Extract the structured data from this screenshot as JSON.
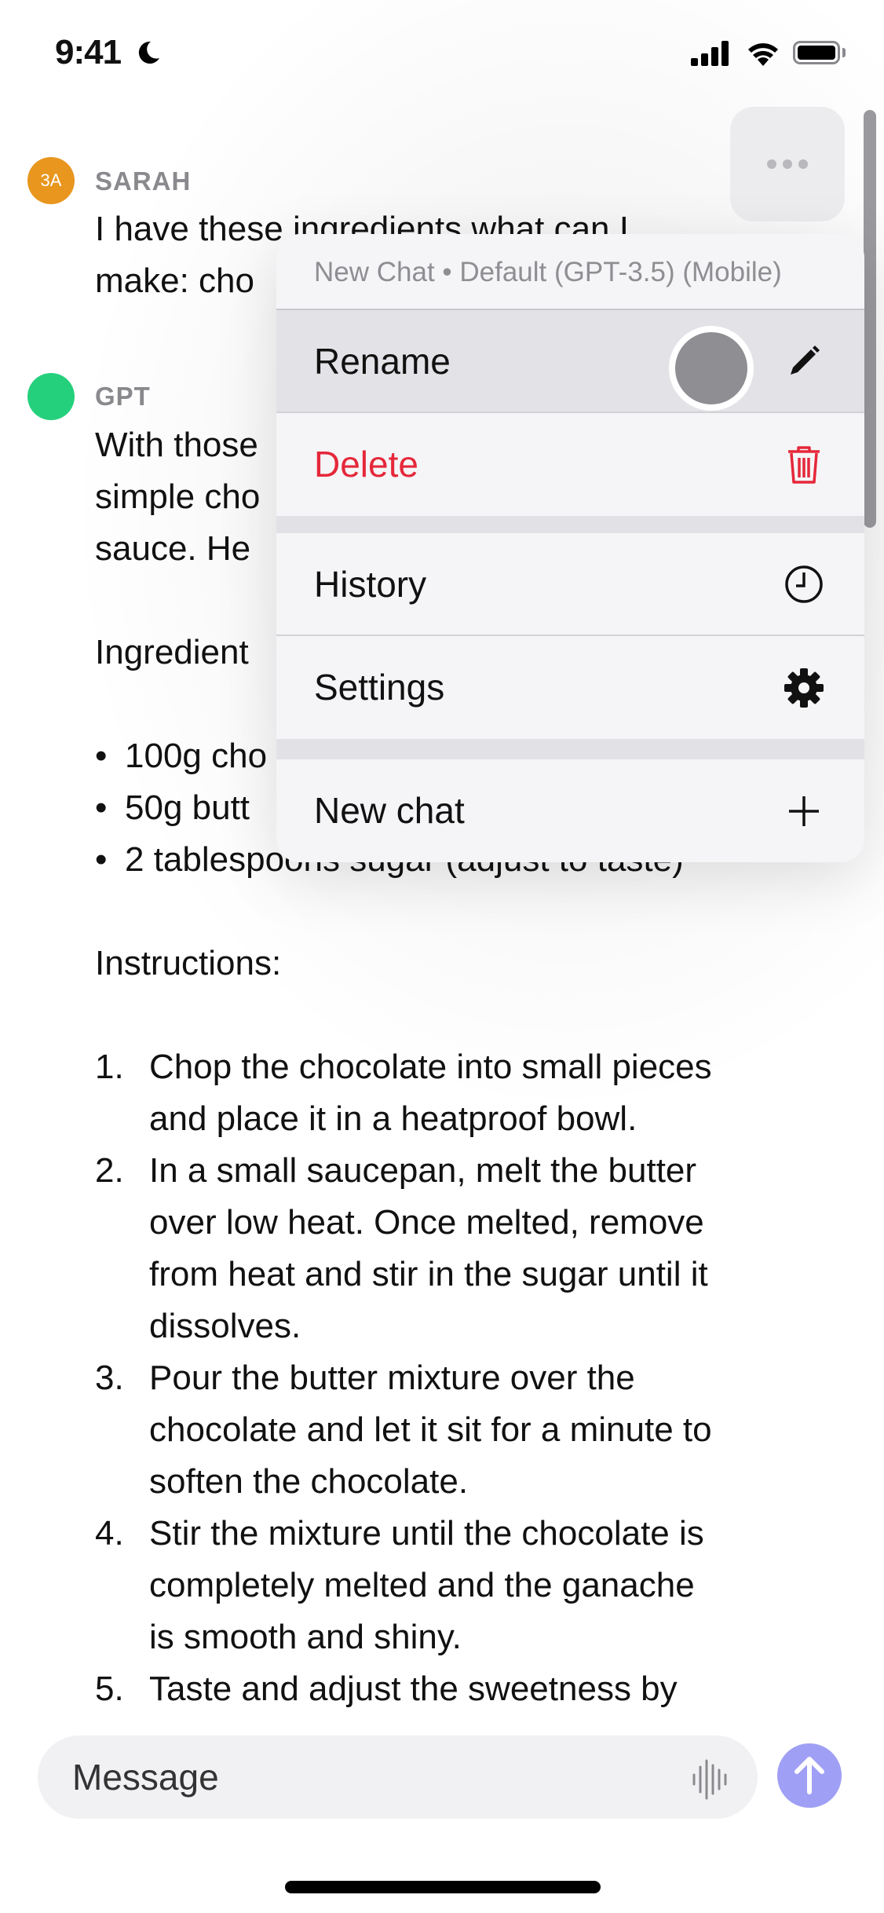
{
  "status_bar": {
    "time": "9:41",
    "focus_icon": "moon-icon",
    "signal_icon": "cellular-signal-icon",
    "wifi_icon": "wifi-icon",
    "battery_icon": "battery-icon"
  },
  "header": {
    "more_icon": "ellipsis-icon"
  },
  "conversation": {
    "user": {
      "avatar_initials": "3A",
      "avatar_color": "#E8961E",
      "name": "SARAH",
      "message_lines": [
        "I have these ingredients what can I",
        "make: cho"
      ]
    },
    "assistant": {
      "avatar_color": "#25D07C",
      "name": "GPT",
      "intro_lines": [
        "With those",
        "simple cho",
        "sauce. He"
      ],
      "ingredients_heading": "Ingredient",
      "ingredients": [
        "100g cho",
        "50g butt",
        "2 tablespoons sugar (adjust to taste)"
      ],
      "instructions_heading": "Instructions:",
      "steps": [
        {
          "num": "1.",
          "lines": [
            "Chop the chocolate into small pieces",
            "and place it in a heatproof bowl."
          ]
        },
        {
          "num": "2.",
          "lines": [
            "In a small saucepan, melt the butter",
            "over low heat. Once melted, remove",
            "from heat and stir in the sugar until it",
            "dissolves."
          ]
        },
        {
          "num": "3.",
          "lines": [
            "Pour the butter mixture over the",
            "chocolate and let it sit for a minute to",
            "soften the chocolate."
          ]
        },
        {
          "num": "4.",
          "lines": [
            "Stir the mixture until the chocolate is",
            "completely melted and the ganache",
            "is smooth and shiny."
          ]
        },
        {
          "num": "5.",
          "lines": [
            "Taste and adjust the sweetness by"
          ]
        }
      ]
    }
  },
  "context_menu": {
    "header": "New Chat • Default (GPT-3.5) (Mobile)",
    "items": [
      {
        "label": "Rename",
        "icon": "pencil-icon",
        "color": "#111111"
      },
      {
        "label": "Delete",
        "icon": "trash-icon",
        "color": "#E5283A"
      },
      {
        "label": "History",
        "icon": "clock-icon",
        "color": "#111111"
      },
      {
        "label": "Settings",
        "icon": "gear-icon",
        "color": "#111111"
      },
      {
        "label": "New chat",
        "icon": "plus-icon",
        "color": "#111111"
      }
    ]
  },
  "composer": {
    "placeholder": "Message",
    "voice_icon": "waveform-icon",
    "send_icon": "arrow-up-icon",
    "send_color": "#9F9FF5"
  }
}
